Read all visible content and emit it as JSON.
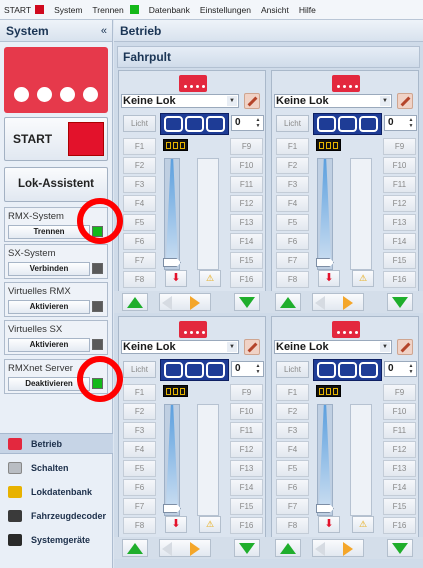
{
  "menu": {
    "items": [
      {
        "label": "START",
        "icon": "red-square-icon",
        "color": "#d0091e"
      },
      {
        "label": "System"
      },
      {
        "label": "Trennen",
        "icon": "green-square-icon",
        "color": "#14b81a"
      },
      {
        "label": "Datenbank"
      },
      {
        "label": "Einstellungen"
      },
      {
        "label": "Ansicht"
      },
      {
        "label": "Hilfe"
      }
    ]
  },
  "sidebar": {
    "title": "System",
    "collapse": "«",
    "start_label": "START",
    "lok_assistant": "Lok-Assistent",
    "groups": [
      {
        "label": "RMX-System",
        "button": "Trennen",
        "indicator": "green"
      },
      {
        "label": "SX-System",
        "button": "Verbinden",
        "indicator": "gray"
      },
      {
        "label": "Virtuelles RMX",
        "button": "Aktivieren",
        "indicator": "gray"
      },
      {
        "label": "Virtuelles SX",
        "button": "Aktivieren",
        "indicator": "gray"
      },
      {
        "label": "RMXnet Server",
        "button": "Deaktivieren",
        "indicator": "green"
      }
    ],
    "nav": [
      {
        "label": "Betrieb",
        "icon": "betrieb-icon",
        "active": true
      },
      {
        "label": "Schalten",
        "icon": "schalten-icon"
      },
      {
        "label": "Lokdatenbank",
        "icon": "lokdatenbank-icon"
      },
      {
        "label": "Fahrzeugdecoder",
        "icon": "fahrzeugdecoder-icon"
      },
      {
        "label": "Systemgeräte",
        "icon": "systemgeraete-icon"
      }
    ]
  },
  "main": {
    "title": "Betrieb",
    "subtitle": "Fahrpult"
  },
  "panels": [
    {
      "loco": "Keine Lok",
      "speed_display": "000",
      "step": "0",
      "licht": "Licht",
      "f_left": [
        "F1",
        "F2",
        "F3",
        "F4",
        "F5",
        "F6",
        "F7",
        "F8"
      ],
      "f_right": [
        "F9",
        "F10",
        "F11",
        "F12",
        "F13",
        "F14",
        "F15",
        "F16"
      ]
    },
    {
      "loco": "Keine Lok",
      "speed_display": "000",
      "step": "0",
      "licht": "Licht",
      "f_left": [
        "F1",
        "F2",
        "F3",
        "F4",
        "F5",
        "F6",
        "F7",
        "F8"
      ],
      "f_right": [
        "F9",
        "F10",
        "F11",
        "F12",
        "F13",
        "F14",
        "F15",
        "F16"
      ]
    },
    {
      "loco": "Keine Lok",
      "speed_display": "000",
      "step": "0",
      "licht": "Licht",
      "f_left": [
        "F1",
        "F2",
        "F3",
        "F4",
        "F5",
        "F6",
        "F7",
        "F8"
      ],
      "f_right": [
        "F9",
        "F10",
        "F11",
        "F12",
        "F13",
        "F14",
        "F15",
        "F16"
      ]
    },
    {
      "loco": "Keine Lok",
      "speed_display": "000",
      "step": "0",
      "licht": "Licht",
      "f_left": [
        "F1",
        "F2",
        "F3",
        "F4",
        "F5",
        "F6",
        "F7",
        "F8"
      ],
      "f_right": [
        "F9",
        "F10",
        "F11",
        "F12",
        "F13",
        "F14",
        "F15",
        "F16"
      ]
    }
  ],
  "colors": {
    "accent_red": "#e3122b",
    "indicator_green": "#14b81a",
    "indicator_gray": "#5a5a5a",
    "speed_display_bg": "#1e3c96",
    "arrow_green": "#1fae2c",
    "arrow_orange": "#f4a62a",
    "highlight_ring": "#ff0000"
  }
}
